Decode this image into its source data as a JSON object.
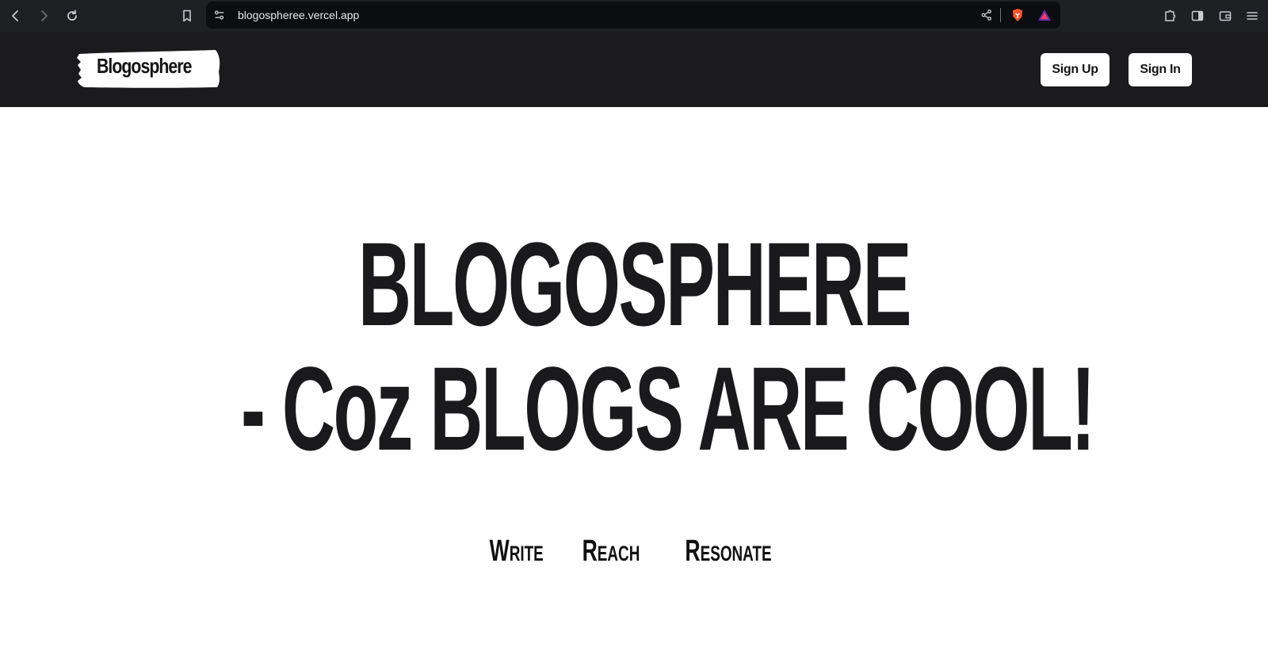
{
  "browser": {
    "url": "blogospheree.vercel.app",
    "icons": [
      "back-icon",
      "forward-icon",
      "reload-icon",
      "bookmark-icon",
      "site-settings-icon",
      "share-icon",
      "brave-shield-icon",
      "brave-rewards-icon",
      "extensions-icon",
      "sidebar-icon",
      "wallet-icon",
      "menu-icon"
    ]
  },
  "header": {
    "logo_text": "Blogosphere",
    "sign_up": "Sign Up",
    "sign_in": "Sign In"
  },
  "hero": {
    "line1": "BLOGOSPHERE",
    "line2": "- Coz BLOGS ARE COOL!",
    "tagline": [
      "Write",
      "Reach",
      "Resonate"
    ]
  },
  "colors": {
    "chrome": "#1f2024",
    "header": "#1b1b1e",
    "text": "#1a1a1c"
  }
}
